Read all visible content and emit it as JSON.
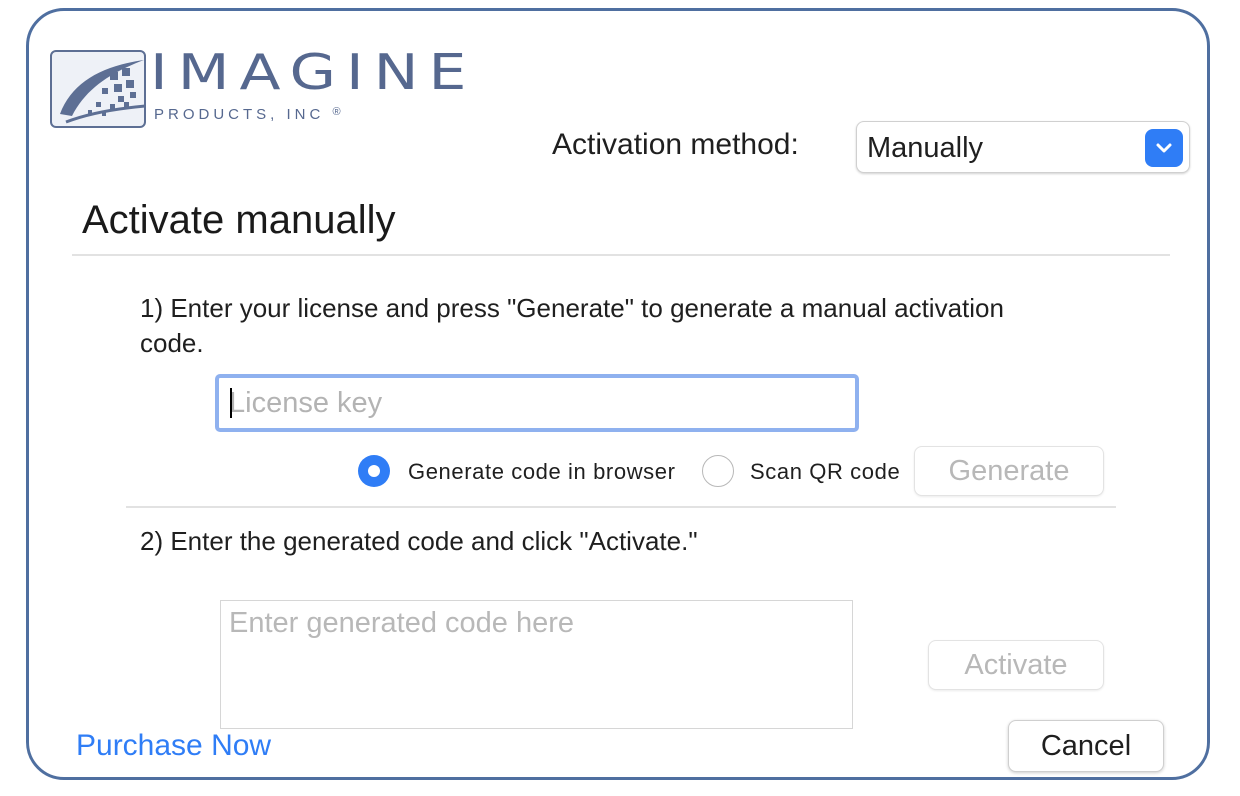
{
  "logo": {
    "wordmark": "IMAGINE",
    "subtitle": "PRODUCTS, INC",
    "registered": "®",
    "icon": "imagine-logo-icon"
  },
  "activation_method": {
    "label": "Activation method:",
    "selected": "Manually",
    "icon": "chevron-down-icon"
  },
  "section": {
    "title": "Activate manually"
  },
  "step1": {
    "instruction": "1) Enter your license and press \"Generate\" to generate a manual activation code.",
    "license_placeholder": "License key",
    "license_value": "",
    "options": [
      {
        "label": "Generate code in browser",
        "selected": true
      },
      {
        "label": "Scan QR code",
        "selected": false
      }
    ],
    "generate_label": "Generate"
  },
  "step2": {
    "instruction": "2) Enter the generated code and click \"Activate.\"",
    "code_placeholder": "Enter generated code here",
    "code_value": "",
    "activate_label": "Activate"
  },
  "footer": {
    "purchase_label": "Purchase Now",
    "cancel_label": "Cancel"
  },
  "colors": {
    "accent": "#2f7df6",
    "window_border": "#4f6fa0",
    "logo": "#56688f",
    "focus_ring": "#8fb1ef",
    "disabled_text": "#b8b8b8"
  }
}
